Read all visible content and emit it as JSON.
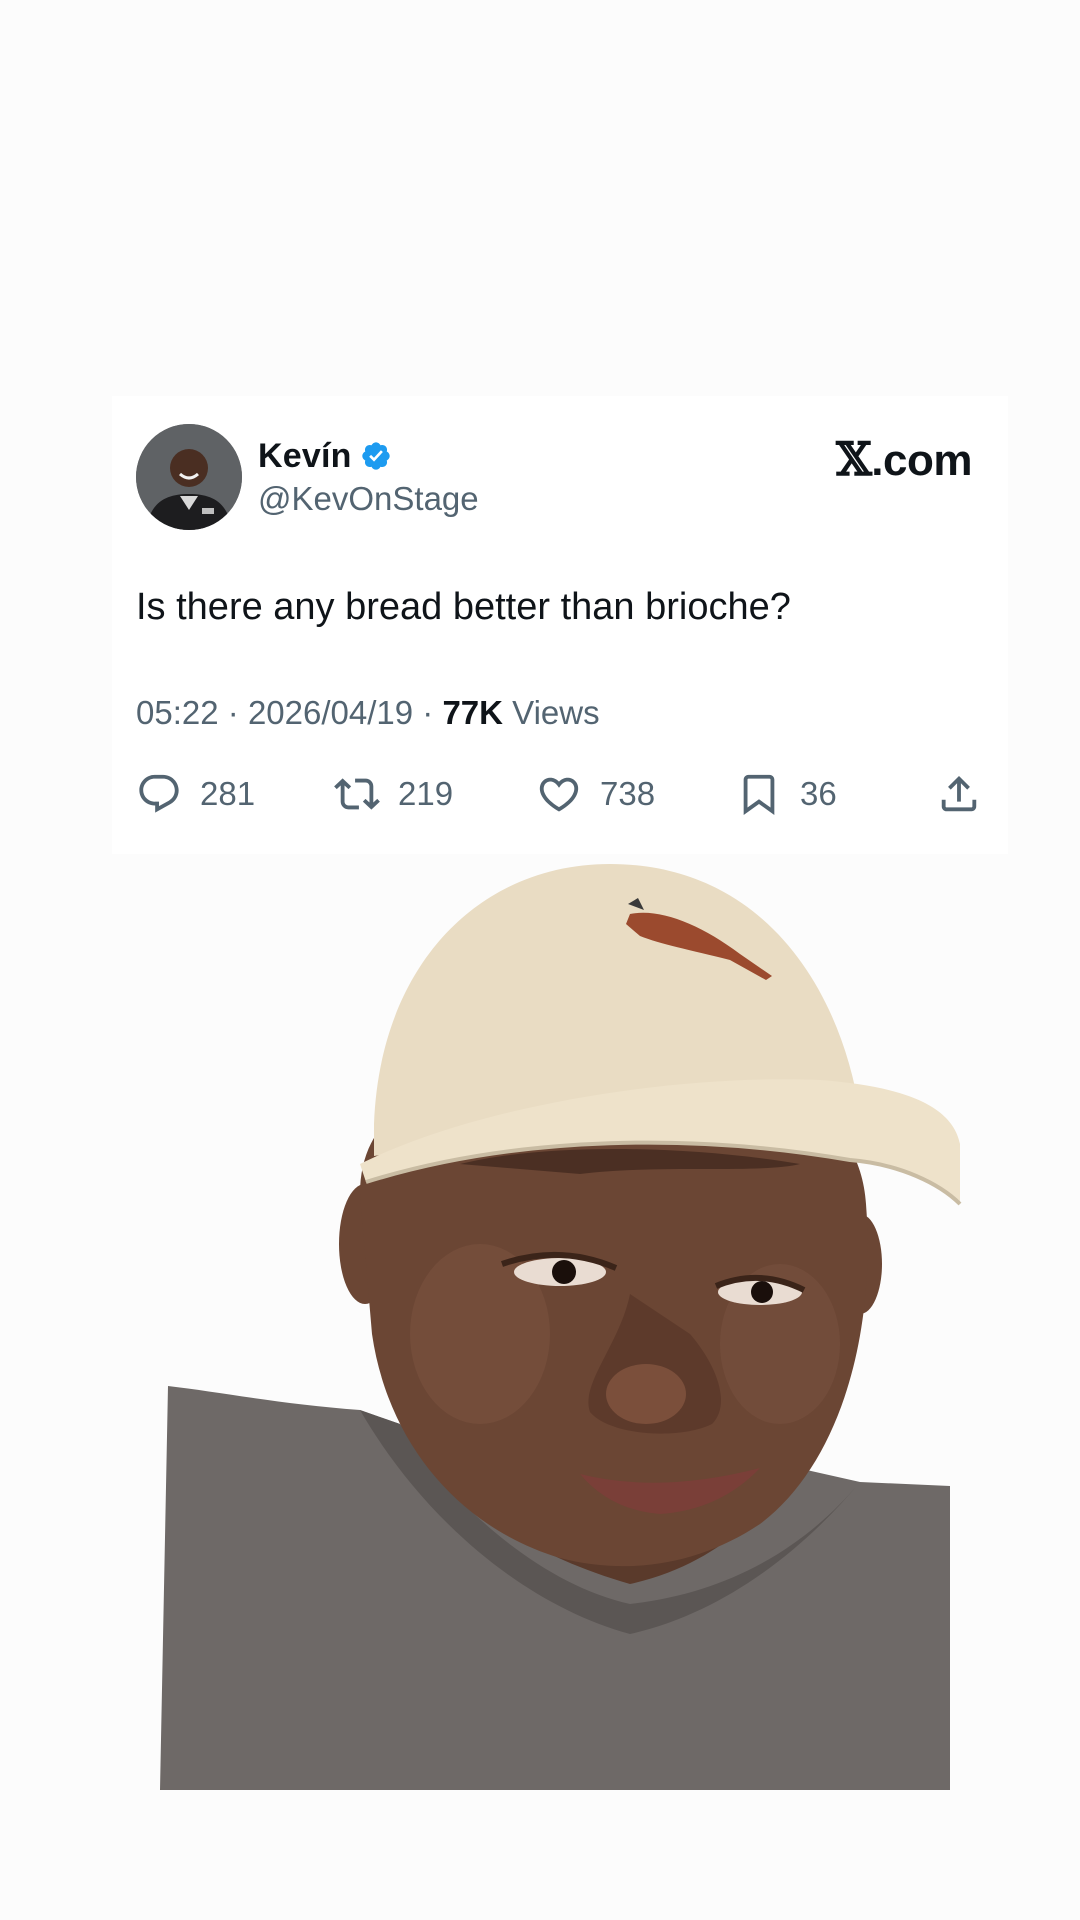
{
  "post": {
    "author_name": "Kevín",
    "handle": "@KevOnStage",
    "brand_x": "𝕏",
    "brand_suffix": ".com",
    "text": "Is there any bread better than brioche?",
    "time": "05:22",
    "separator": "·",
    "date": "2026/04/19",
    "views_count": "77K",
    "views_label": "Views"
  },
  "actions": {
    "replies": "281",
    "reposts": "219",
    "likes": "738",
    "bookmarks": "36"
  },
  "icons": {
    "avatar": "avatar-photo",
    "verified": "verified-badge-icon",
    "reply": "reply-icon",
    "repost": "repost-icon",
    "like": "heart-icon",
    "bookmark": "bookmark-icon",
    "share": "share-icon"
  },
  "colors": {
    "verified_blue": "#1d9bf0",
    "text_primary": "#0f1419",
    "text_secondary": "#536471",
    "hat": "#e9dcc3",
    "shirt": "#6e6967",
    "skin": "#6b4634"
  }
}
